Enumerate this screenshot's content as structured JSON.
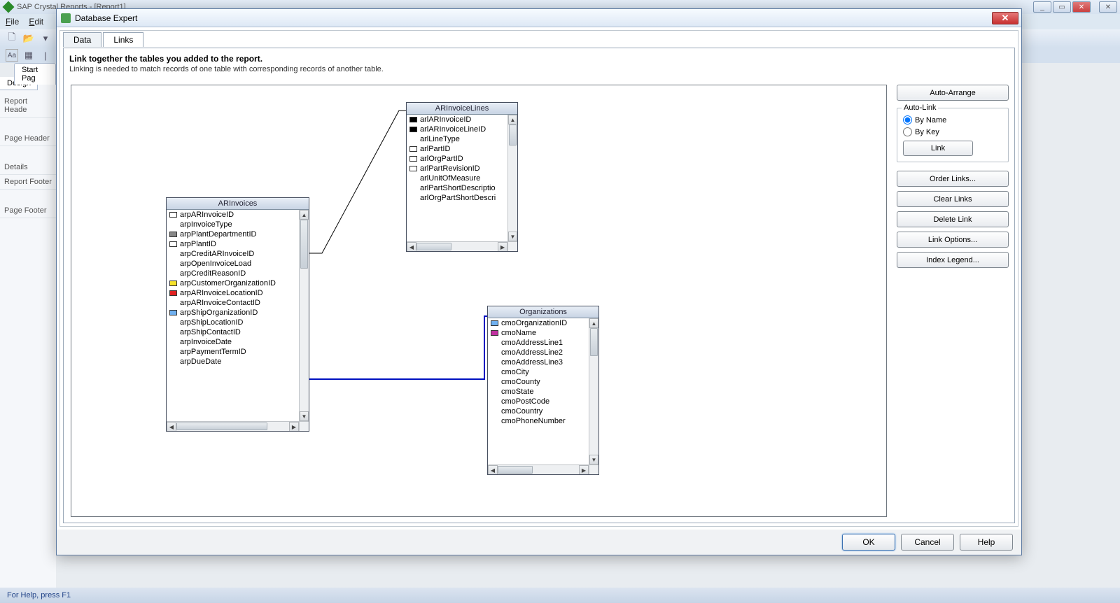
{
  "app": {
    "title": "SAP Crystal Reports - [Report1]",
    "menu": {
      "file": "File",
      "edit": "Edit"
    },
    "tabs": {
      "start": "Start Pag",
      "design": "Design"
    },
    "sections": [
      "Report Heade",
      "Page Header",
      "Details",
      "Report Footer",
      "Page Footer"
    ],
    "status": "For Help, press F1"
  },
  "dialog": {
    "title": "Database Expert",
    "tabs": {
      "data": "Data",
      "links": "Links"
    },
    "instruction_bold": "Link together the tables you added to the report.",
    "instruction_text": "Linking is needed to match records of one table with corresponding records of another table.",
    "side": {
      "auto_arrange": "Auto-Arrange",
      "auto_link_group": "Auto-Link",
      "by_name": "By Name",
      "by_key": "By Key",
      "link": "Link",
      "order_links": "Order Links...",
      "clear_links": "Clear Links",
      "delete_link": "Delete Link",
      "link_options": "Link Options...",
      "index_legend": "Index Legend..."
    },
    "footer": {
      "ok": "OK",
      "cancel": "Cancel",
      "help": "Help"
    }
  },
  "tables": {
    "ar_invoices": {
      "title": "ARInvoices",
      "fields": [
        {
          "icon": "white",
          "name": "arpARInvoiceID"
        },
        {
          "icon": "none",
          "name": "arpInvoiceType"
        },
        {
          "icon": "gray",
          "name": "arpPlantDepartmentID"
        },
        {
          "icon": "white",
          "name": "arpPlantID"
        },
        {
          "icon": "none",
          "name": "arpCreditARInvoiceID"
        },
        {
          "icon": "none",
          "name": "arpOpenInvoiceLoad"
        },
        {
          "icon": "none",
          "name": "arpCreditReasonID"
        },
        {
          "icon": "yellow",
          "name": "arpCustomerOrganizationID"
        },
        {
          "icon": "red",
          "name": "arpARInvoiceLocationID"
        },
        {
          "icon": "none",
          "name": "arpARInvoiceContactID"
        },
        {
          "icon": "blue",
          "name": "arpShipOrganizationID"
        },
        {
          "icon": "none",
          "name": "arpShipLocationID"
        },
        {
          "icon": "none",
          "name": "arpShipContactID"
        },
        {
          "icon": "none",
          "name": "arpInvoiceDate"
        },
        {
          "icon": "none",
          "name": "arpPaymentTermID"
        },
        {
          "icon": "none",
          "name": "arpDueDate"
        }
      ]
    },
    "ar_invoice_lines": {
      "title": "ARInvoiceLines",
      "fields": [
        {
          "icon": "black",
          "name": "arlARInvoiceID"
        },
        {
          "icon": "black",
          "name": "arlARInvoiceLineID"
        },
        {
          "icon": "none",
          "name": "arlLineType"
        },
        {
          "icon": "white",
          "name": "arlPartID"
        },
        {
          "icon": "white",
          "name": "arlOrgPartID"
        },
        {
          "icon": "white",
          "name": "arlPartRevisionID"
        },
        {
          "icon": "none",
          "name": "arlUnitOfMeasure"
        },
        {
          "icon": "none",
          "name": "arlPartShortDescriptio"
        },
        {
          "icon": "none",
          "name": "arlOrgPartShortDescri"
        }
      ]
    },
    "organizations": {
      "title": "Organizations",
      "fields": [
        {
          "icon": "blue",
          "name": "cmoOrganizationID"
        },
        {
          "icon": "magenta",
          "name": "cmoName"
        },
        {
          "icon": "none",
          "name": "cmoAddressLine1"
        },
        {
          "icon": "none",
          "name": "cmoAddressLine2"
        },
        {
          "icon": "none",
          "name": "cmoAddressLine3"
        },
        {
          "icon": "none",
          "name": "cmoCity"
        },
        {
          "icon": "none",
          "name": "cmoCounty"
        },
        {
          "icon": "none",
          "name": "cmoState"
        },
        {
          "icon": "none",
          "name": "cmoPostCode"
        },
        {
          "icon": "none",
          "name": "cmoCountry"
        },
        {
          "icon": "none",
          "name": "cmoPhoneNumber"
        }
      ]
    }
  }
}
